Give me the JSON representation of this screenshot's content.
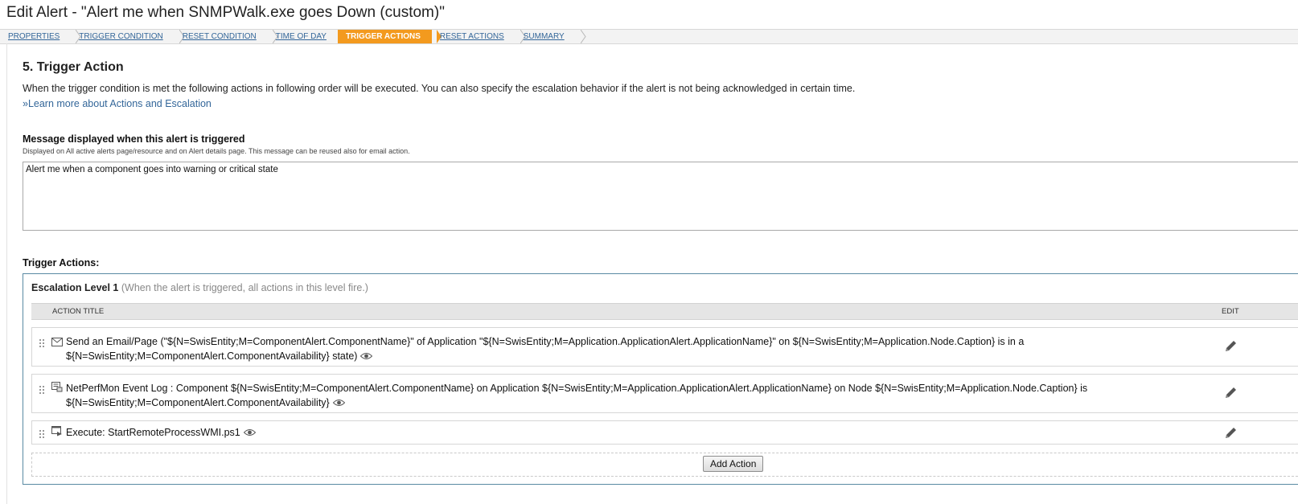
{
  "page": {
    "title": "Edit Alert - \"Alert me when SNMPWalk.exe goes Down (custom)\""
  },
  "breadcrumb": {
    "steps": [
      {
        "label": "PROPERTIES",
        "active": false
      },
      {
        "label": "TRIGGER CONDITION",
        "active": false
      },
      {
        "label": "RESET CONDITION",
        "active": false
      },
      {
        "label": "TIME OF DAY",
        "active": false
      },
      {
        "label": "TRIGGER ACTIONS",
        "active": true
      },
      {
        "label": "RESET ACTIONS",
        "active": false
      },
      {
        "label": "SUMMARY",
        "active": false
      }
    ],
    "active_color": "#f39a1e",
    "link_color": "#336699"
  },
  "section": {
    "title": "5. Trigger Action",
    "intro": "When the trigger condition is met the following actions in following order will be executed. You can also specify the escalation behavior if the alert is not being acknowledged in certain time.",
    "learn_more": "»Learn more about Actions and Escalation"
  },
  "message": {
    "label": "Message displayed when this alert is triggered",
    "help": "Displayed on All active alerts page/resource and on Alert details page. This message can be reused also for email action.",
    "value": "Alert me when a component goes into warning or critical state"
  },
  "trigger_actions": {
    "label": "Trigger Actions:",
    "escalation_level": {
      "title": "Escalation Level 1",
      "note": "(When the alert is triggered, all actions in this level fire.)"
    },
    "columns": {
      "action_title": "ACTION TITLE",
      "edit": "EDIT"
    },
    "actions": [
      {
        "icon": "email-icon",
        "text": "Send an Email/Page (\"${N=SwisEntity;M=ComponentAlert.ComponentName}\" of Application \"${N=SwisEntity;M=Application.ApplicationAlert.ApplicationName}\" on ${N=SwisEntity;M=Application.Node.Caption} is in a ${N=SwisEntity;M=ComponentAlert.ComponentAvailability} state)"
      },
      {
        "icon": "event-log-icon",
        "text": "NetPerfMon Event Log : Component ${N=SwisEntity;M=ComponentAlert.ComponentName} on Application ${N=SwisEntity;M=Application.ApplicationAlert.ApplicationName} on Node ${N=SwisEntity;M=Application.Node.Caption} is ${N=SwisEntity;M=ComponentAlert.ComponentAvailability}"
      },
      {
        "icon": "execute-icon",
        "text": "Execute: StartRemoteProcessWMI.ps1"
      }
    ],
    "add_action_label": "Add Action"
  }
}
